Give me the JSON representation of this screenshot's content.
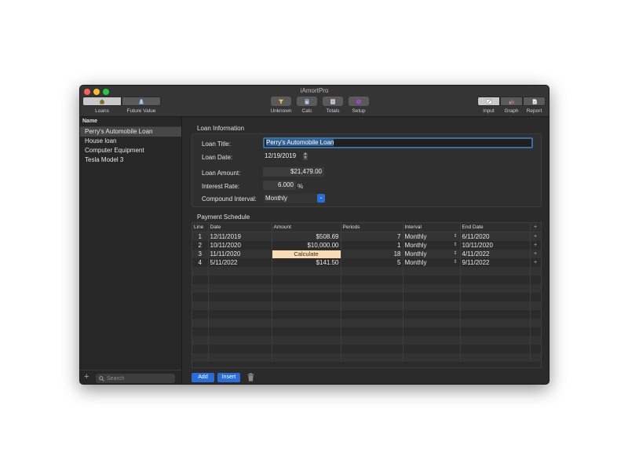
{
  "window": {
    "title": "iAmortPro"
  },
  "toolbar": {
    "left_group": [
      {
        "label": "Loans",
        "icon": "house-icon"
      },
      {
        "label": "Future Value",
        "icon": "road-icon"
      }
    ],
    "center": [
      {
        "label": "Unknown",
        "icon": "funnel-icon"
      },
      {
        "label": "Calc",
        "icon": "calculator-icon"
      },
      {
        "label": "Totals",
        "icon": "totals-icon"
      },
      {
        "label": "Setup",
        "icon": "gear-icon"
      }
    ],
    "right_group": [
      {
        "label": "Input",
        "icon": "input-icon"
      },
      {
        "label": "Graph",
        "icon": "graph-icon"
      },
      {
        "label": "Report",
        "icon": "report-icon"
      }
    ]
  },
  "sidebar": {
    "header": "Name",
    "items": [
      "Perry's Automobile Loan",
      "House loan",
      "Computer Equipment",
      "Tesla Model 3"
    ],
    "selected_index": 0,
    "add_label": "+",
    "search_placeholder": "Search"
  },
  "loan_info": {
    "section_title": "Loan Information",
    "title_label": "Loan Title:",
    "title_value": "Perry's Automobile Loan",
    "date_label": "Loan Date:",
    "date_value": "12/19/2019",
    "amount_label": "Loan Amount:",
    "amount_value": "$21,479.00",
    "rate_label": "Interest Rate:",
    "rate_value": "6.000",
    "rate_unit": "%",
    "compound_label": "Compound Interval:",
    "compound_value": "Monthly"
  },
  "schedule": {
    "section_title": "Payment Schedule",
    "columns": [
      "Line",
      "Date",
      "Amount",
      "Periods",
      "Interval",
      "End Date",
      "+"
    ],
    "rows": [
      {
        "line": "1",
        "date": "12/11/2019",
        "amount": "$508.69",
        "periods": "7",
        "interval": "Monthly",
        "end_date": "6/11/2020"
      },
      {
        "line": "2",
        "date": "10/11/2020",
        "amount": "$10,000.00",
        "periods": "1",
        "interval": "Monthly",
        "end_date": "10/11/2020"
      },
      {
        "line": "3",
        "date": "11/11/2020",
        "amount": "Calculate",
        "periods": "18",
        "interval": "Monthly",
        "end_date": "4/11/2022"
      },
      {
        "line": "4",
        "date": "5/11/2022",
        "amount": "$141.50",
        "periods": "5",
        "interval": "Monthly",
        "end_date": "9/11/2022"
      }
    ],
    "row_plus": "+",
    "empty_rows": 11,
    "add_label": "Add",
    "insert_label": "Insert"
  },
  "colors": {
    "accent": "#2b6dd8",
    "calculate_bg": "#f9dcb5",
    "window_bg": "#2b2b2b",
    "sidebar_selected": "#474747"
  }
}
